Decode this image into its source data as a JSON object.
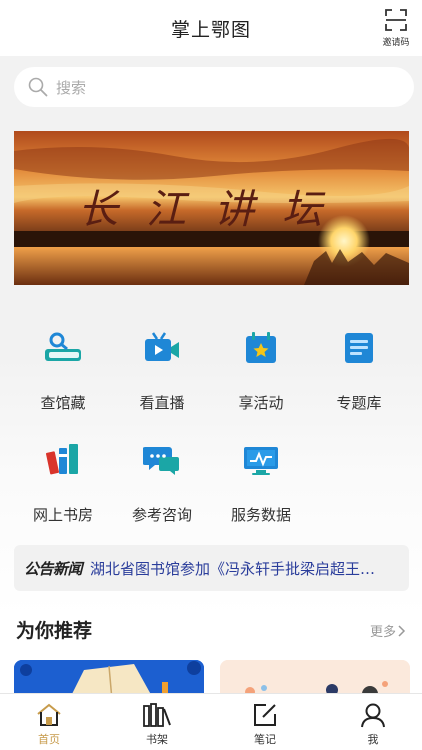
{
  "header": {
    "title": "掌上鄂图",
    "invite_label": "邀请码"
  },
  "search": {
    "placeholder": "搜索"
  },
  "banner": {
    "text": "长江讲坛"
  },
  "grid": {
    "items": [
      {
        "label": "查馆藏",
        "icon": "book-search-icon"
      },
      {
        "label": "看直播",
        "icon": "video-camera-icon"
      },
      {
        "label": "享活动",
        "icon": "calendar-star-icon"
      },
      {
        "label": "专题库",
        "icon": "document-list-icon"
      },
      {
        "label": "网上书房",
        "icon": "books-icon"
      },
      {
        "label": "参考咨询",
        "icon": "chat-bubbles-icon"
      },
      {
        "label": "服务数据",
        "icon": "monitor-chart-icon"
      }
    ]
  },
  "notice": {
    "tag": "公告新闻",
    "text": "湖北省图书馆参加《冯永轩手批梁启超王…"
  },
  "recommend": {
    "title": "为你推荐",
    "more": "更多"
  },
  "tabbar": {
    "items": [
      {
        "label": "首页",
        "icon": "home-icon",
        "active": true
      },
      {
        "label": "书架",
        "icon": "bookshelf-icon",
        "active": false
      },
      {
        "label": "笔记",
        "icon": "edit-note-icon",
        "active": false
      },
      {
        "label": "我",
        "icon": "user-icon",
        "active": false
      }
    ]
  },
  "colors": {
    "accent": "#c79b4b",
    "notice_link": "#2a3d9b",
    "icon_blue": "#1f87d6",
    "icon_teal": "#1ba6a6"
  }
}
